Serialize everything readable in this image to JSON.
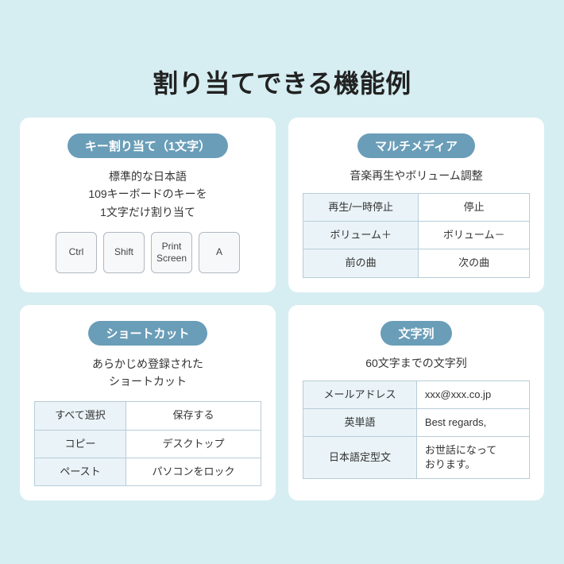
{
  "title": "割り当てできる機能例",
  "cards": {
    "key_assign": {
      "header": "キー割り当て（1文字）",
      "description": "標準的な日本語\n109キーボードのキーを\n1文字だけ割り当て",
      "keys": [
        "Ctrl",
        "Shift",
        "Print\nScreen",
        "A"
      ]
    },
    "multimedia": {
      "header": "マルチメディア",
      "description": "音楽再生やボリューム調整",
      "table": [
        [
          "再生/一時停止",
          "停止"
        ],
        [
          "ボリューム＋",
          "ボリューム－"
        ],
        [
          "前の曲",
          "次の曲"
        ]
      ]
    },
    "shortcut": {
      "header": "ショートカット",
      "description": "あらかじめ登録された\nショートカット",
      "table": [
        [
          "すべて選択",
          "保存する"
        ],
        [
          "コピー",
          "デスクトップ"
        ],
        [
          "ペースト",
          "パソコンをロック"
        ]
      ]
    },
    "string": {
      "header": "文字列",
      "description": "60文字までの文字列",
      "table": [
        [
          "メールアドレス",
          "xxx@xxx.co.jp"
        ],
        [
          "英単語",
          "Best regards,"
        ],
        [
          "日本語定型文",
          "お世話になって\nおります。"
        ]
      ]
    }
  }
}
